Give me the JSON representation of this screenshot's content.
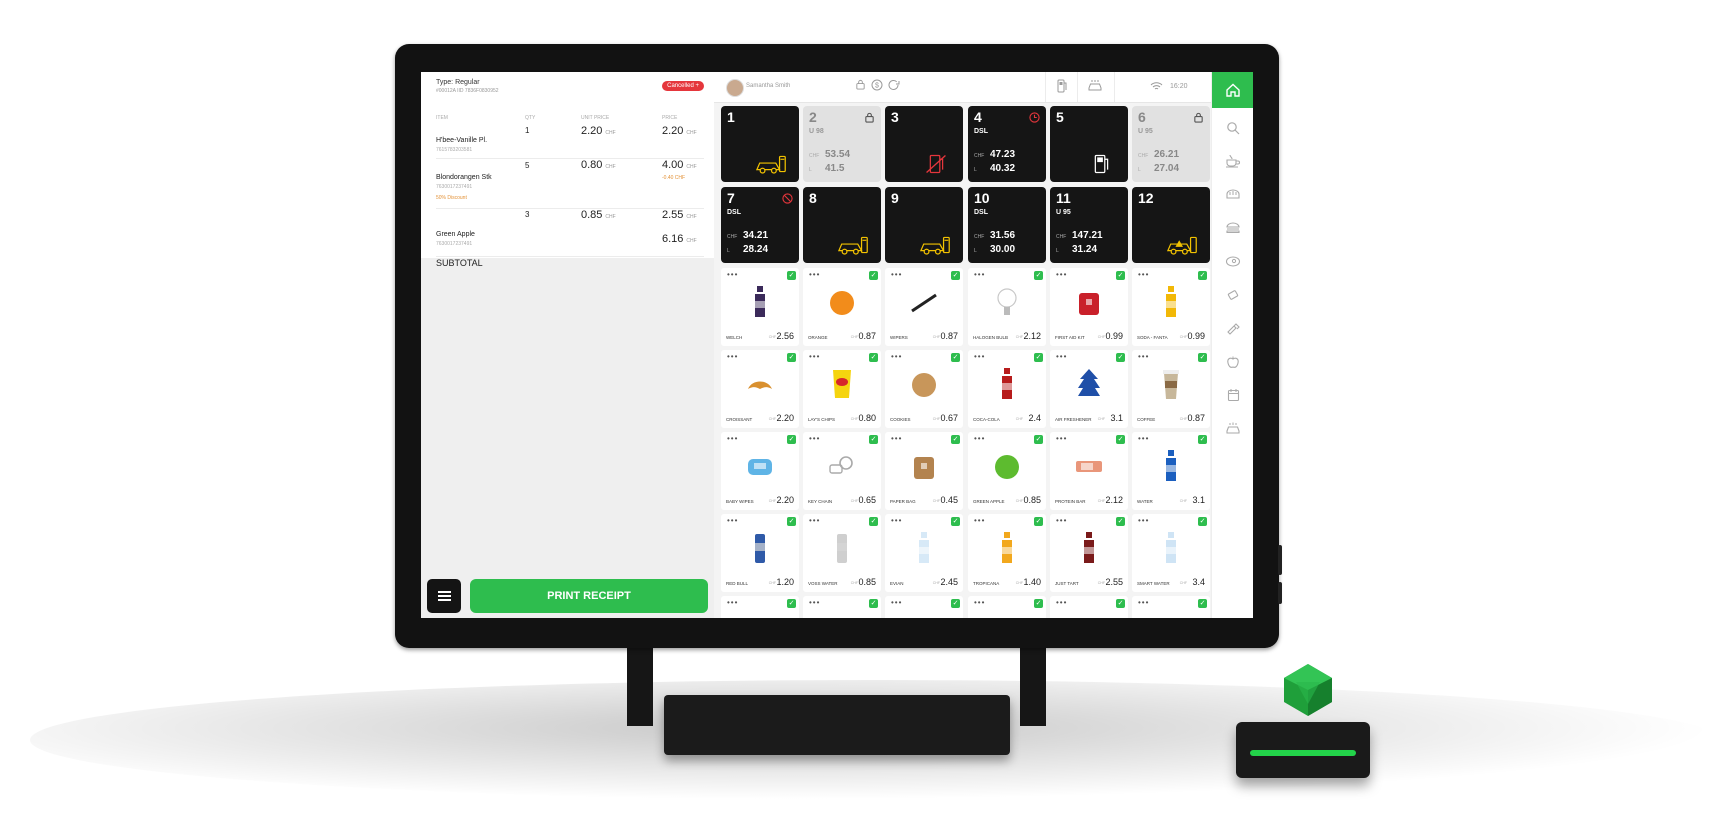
{
  "order": {
    "type_label": "Type: Regular",
    "order_id": "#00012A IID 7836F0830952",
    "status": "Cancelled +",
    "columns": {
      "item": "ITEM",
      "qty": "QTY",
      "unit_price": "UNIT PRICE",
      "price": "PRICE"
    },
    "items": [
      {
        "name": "H'bee-Vanille Pl.",
        "code": "7615783203581",
        "qty": "1",
        "unit_price": "2.20",
        "price": "2.20",
        "currency": "CHF",
        "discount_label": "",
        "discount_value": ""
      },
      {
        "name": "Blondorangen Stk",
        "code": "7630017237491",
        "qty": "5",
        "unit_price": "0.80",
        "price": "4.00",
        "currency": "CHF",
        "discount_label": "50% Discount",
        "discount_value": "-0.40 CHF"
      },
      {
        "name": "Green Apple",
        "code": "7630017237491",
        "qty": "3",
        "unit_price": "0.85",
        "price": "2.55",
        "currency": "CHF",
        "discount_label": "",
        "discount_value": ""
      }
    ],
    "extra_price": "6.16",
    "subtotal_label": "SUBTOTAL",
    "print_label": "PRINT RECEIPT"
  },
  "topbar": {
    "user_name": "Samantha Smith",
    "time": "16:20"
  },
  "pumps": [
    {
      "number": "1",
      "fuel": "",
      "chf": "",
      "liters": "",
      "chf_label": "",
      "l_label": "",
      "state": "active",
      "status_icon": "",
      "icon": "car-icon"
    },
    {
      "number": "2",
      "fuel": "U 98",
      "chf": "53.54",
      "liters": "41.5",
      "chf_label": "CHF",
      "l_label": "L",
      "state": "locked",
      "status_icon": "lock-icon",
      "icon": ""
    },
    {
      "number": "3",
      "fuel": "",
      "chf": "",
      "liters": "",
      "chf_label": "",
      "l_label": "",
      "state": "active",
      "status_icon": "",
      "icon": "pump-disabled-icon"
    },
    {
      "number": "4",
      "fuel": "DSL",
      "chf": "47.23",
      "liters": "40.32",
      "chf_label": "CHF",
      "l_label": "L",
      "state": "active",
      "status_icon": "clock-icon",
      "icon": ""
    },
    {
      "number": "5",
      "fuel": "",
      "chf": "",
      "liters": "",
      "chf_label": "",
      "l_label": "",
      "state": "active",
      "status_icon": "",
      "icon": "fuel-pump-icon"
    },
    {
      "number": "6",
      "fuel": "U 95",
      "chf": "26.21",
      "liters": "27.04",
      "chf_label": "CHF",
      "l_label": "L",
      "state": "locked",
      "status_icon": "lock-icon",
      "icon": ""
    },
    {
      "number": "7",
      "fuel": "DSL",
      "chf": "34.21",
      "liters": "28.24",
      "chf_label": "CHF",
      "l_label": "L",
      "state": "active",
      "status_icon": "blocked-icon",
      "icon": ""
    },
    {
      "number": "8",
      "fuel": "",
      "chf": "",
      "liters": "",
      "chf_label": "",
      "l_label": "",
      "state": "active",
      "status_icon": "",
      "icon": "car-icon"
    },
    {
      "number": "9",
      "fuel": "",
      "chf": "",
      "liters": "",
      "chf_label": "",
      "l_label": "",
      "state": "active",
      "status_icon": "",
      "icon": "car-icon"
    },
    {
      "number": "10",
      "fuel": "DSL",
      "chf": "31.56",
      "liters": "30.00",
      "chf_label": "CHF",
      "l_label": "L",
      "state": "active",
      "status_icon": "",
      "icon": ""
    },
    {
      "number": "11",
      "fuel": "U 95",
      "chf": "147.21",
      "liters": "31.24",
      "chf_label": "CHF",
      "l_label": "L",
      "state": "active",
      "status_icon": "",
      "icon": ""
    },
    {
      "number": "12",
      "fuel": "",
      "chf": "",
      "liters": "",
      "chf_label": "",
      "l_label": "",
      "state": "active",
      "status_icon": "",
      "icon": "car-warning-icon"
    }
  ],
  "products": [
    {
      "name": "WELCH",
      "price": "2.56",
      "color": "#3b2a5a",
      "shape": "bottle"
    },
    {
      "name": "ORANGE",
      "price": "0.87",
      "color": "#f28c1b",
      "shape": "round"
    },
    {
      "name": "WIPERS",
      "price": "0.87",
      "color": "#222222",
      "shape": "wiper"
    },
    {
      "name": "HALOGEN BULB",
      "price": "2.12",
      "color": "#d9d9d9",
      "shape": "bulb"
    },
    {
      "name": "FIRST AID KIT",
      "price": "0.99",
      "color": "#c9202a",
      "shape": "box"
    },
    {
      "name": "SODA - FANTA",
      "price": "0.99",
      "color": "#f2b807",
      "shape": "bottle"
    },
    {
      "name": "CROISSANT",
      "price": "2.20",
      "color": "#d9902f",
      "shape": "croissant"
    },
    {
      "name": "LAY'S CHIPS",
      "price": "0.80",
      "color": "#f5d40f",
      "shape": "bag"
    },
    {
      "name": "COOKIES",
      "price": "0.67",
      "color": "#c8965a",
      "shape": "round"
    },
    {
      "name": "COCA-COLA",
      "price": "2.4",
      "color": "#b71c1c",
      "shape": "bottle"
    },
    {
      "name": "AIR FRESHENER",
      "price": "3.1",
      "color": "#1f4fa8",
      "shape": "tree"
    },
    {
      "name": "COFFEE",
      "price": "0.87",
      "color": "#c7b79a",
      "shape": "cup"
    },
    {
      "name": "BABY WIPES",
      "price": "2.20",
      "color": "#5fb4e6",
      "shape": "pack"
    },
    {
      "name": "KEY CHAIN",
      "price": "0.65",
      "color": "#aaaaaa",
      "shape": "ring"
    },
    {
      "name": "PAPER BAG",
      "price": "0.45",
      "color": "#b3834f",
      "shape": "box"
    },
    {
      "name": "GREEN APPLE",
      "price": "0.85",
      "color": "#5dbb2f",
      "shape": "round"
    },
    {
      "name": "PROTEIN BAR",
      "price": "2.12",
      "color": "#e9967a",
      "shape": "bar"
    },
    {
      "name": "WATER",
      "price": "3.1",
      "color": "#1b5fbf",
      "shape": "bottle"
    },
    {
      "name": "RED BULL",
      "price": "1.20",
      "color": "#2f5aa8",
      "shape": "can"
    },
    {
      "name": "VOSS WATER",
      "price": "0.85",
      "color": "#cfcfcf",
      "shape": "can"
    },
    {
      "name": "EVIAN",
      "price": "2.45",
      "color": "#d7e9f7",
      "shape": "bottle"
    },
    {
      "name": "TROPICANA",
      "price": "1.40",
      "color": "#f2a81d",
      "shape": "bottle"
    },
    {
      "name": "JUST TART",
      "price": "2.55",
      "color": "#7a1a1a",
      "shape": "bottle"
    },
    {
      "name": "SMART WATER",
      "price": "3.4",
      "color": "#cfe4f5",
      "shape": "bottle"
    }
  ],
  "currency": "CHF",
  "colors": {
    "accent": "#2ebd4e",
    "danger": "#e5363c",
    "pump_dark": "#151515",
    "pump_icon": "#f2c200"
  }
}
